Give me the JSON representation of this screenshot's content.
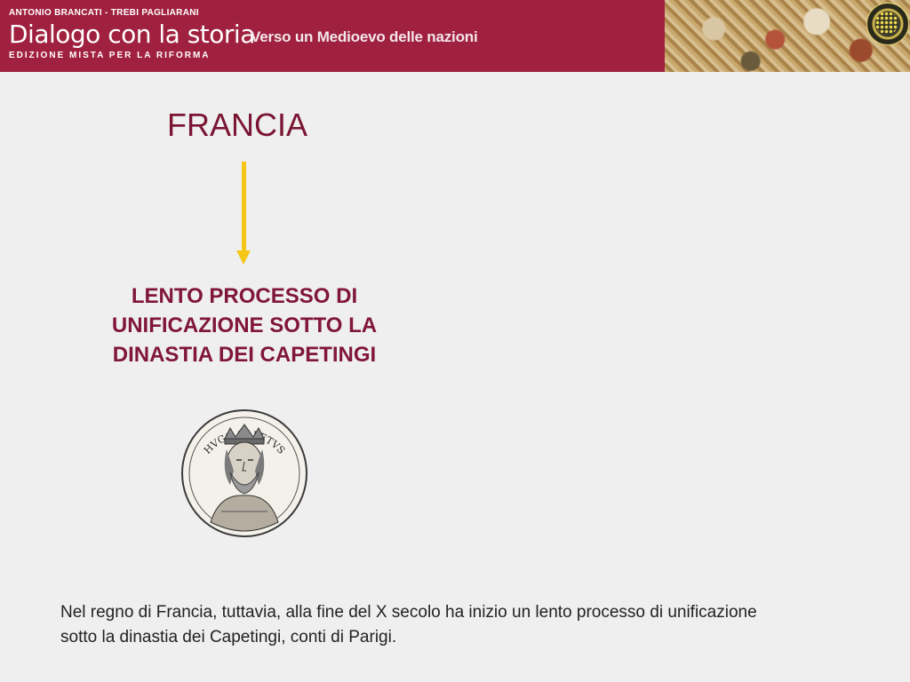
{
  "header": {
    "authors": "ANTONIO BRANCATI - TREBI PAGLIARANI",
    "series_title": "Dialogo con la storia",
    "edition": "EDIZIONE MISTA PER LA RIFORMA",
    "subtitle": "Verso un Medioevo delle nazioni",
    "badge_icon": "aula-digitale-badge-icon"
  },
  "slide": {
    "heading": "FRANCIA",
    "arrow_icon": "down-arrow-icon",
    "description": "LENTO PROCESSO DI UNIFICAZIONE SOTTO LA DINASTIA DEI CAPETINGI",
    "coin_image": "hugo-capetus-coin-portrait",
    "coin_inscription": "HVGO CAPETVS",
    "body_text": "Nel regno di Francia, tuttavia, alla fine del X secolo ha inizio un lento processo di unificazione sotto la dinastia dei Capetingi, conti di Parigi."
  },
  "colors": {
    "header_bg": "#a0213f",
    "heading": "#7a1533",
    "arrow": "#f5c518",
    "page_bg": "#efefef"
  }
}
